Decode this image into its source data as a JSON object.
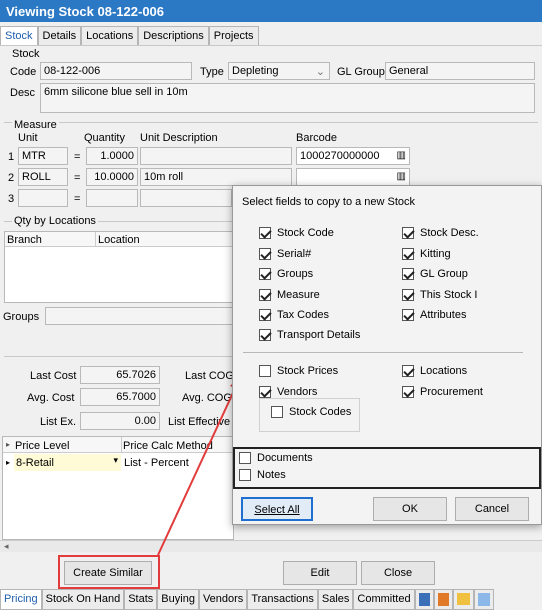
{
  "window": {
    "title": "Viewing Stock 08-122-006"
  },
  "tabs": [
    "Stock",
    "Details",
    "Locations",
    "Descriptions",
    "Projects"
  ],
  "stock": {
    "section": "Stock",
    "code_label": "Code",
    "code": "08-122-006",
    "type_label": "Type",
    "type": "Depleting",
    "gl_label": "GL Group",
    "gl": "General",
    "desc_label": "Desc",
    "desc": "6mm silicone blue sell in 10m"
  },
  "measure": {
    "section": "Measure",
    "unit_label": "Unit",
    "qty_label": "Quantity",
    "udesc_label": "Unit Description",
    "barcode_label": "Barcode",
    "rows": [
      {
        "n": "1",
        "unit": "MTR",
        "eq": "=",
        "qty": "1.0000",
        "udesc": "",
        "barcode": "1000270000000"
      },
      {
        "n": "2",
        "unit": "ROLL",
        "eq": "=",
        "qty": "10.0000",
        "udesc": "10m roll",
        "barcode": ""
      },
      {
        "n": "3",
        "unit": "",
        "eq": "=",
        "qty": "",
        "udesc": "",
        "barcode": ""
      }
    ]
  },
  "qty_locations": {
    "section": "Qty by Locations",
    "col_branch": "Branch",
    "col_location": "Location"
  },
  "groups_label": "Groups",
  "costs": {
    "last_cost_label": "Last Cost",
    "last_cost": "65.7026",
    "avg_cost_label": "Avg. Cost",
    "avg_cost": "65.7000",
    "list_ex_label": "List Ex.",
    "list_ex": "0.00",
    "last_cog_label": "Last COG",
    "avg_cog_label": "Avg. COG",
    "list_eff_label": "List Effective"
  },
  "price": {
    "col_level": "Price Level",
    "col_method": "Price Calc Method",
    "level": "8-Retail",
    "method": "List - Percent"
  },
  "buttons": {
    "create_similar": "Create Similar",
    "edit": "Edit",
    "close": "Close"
  },
  "bottom_tabs": [
    "Pricing",
    "Stock On Hand",
    "Stats",
    "Buying",
    "Vendors",
    "Transactions",
    "Sales",
    "Committed"
  ],
  "dialog": {
    "title": "Select fields to copy to a new Stock",
    "left": [
      {
        "label": "Stock Code",
        "checked": true
      },
      {
        "label": "Serial#",
        "checked": true
      },
      {
        "label": "Groups",
        "checked": true
      },
      {
        "label": "Measure",
        "checked": true
      },
      {
        "label": "Tax Codes",
        "checked": true
      },
      {
        "label": "Transport Details",
        "checked": true
      }
    ],
    "right": [
      {
        "label": "Stock Desc.",
        "checked": true
      },
      {
        "label": "Kitting",
        "checked": true
      },
      {
        "label": "GL Group",
        "checked": true
      },
      {
        "label": "This Stock I",
        "checked": true
      },
      {
        "label": "Attributes",
        "checked": true
      }
    ],
    "stock_prices": "Stock Prices",
    "vendors": "Vendors",
    "stock_codes": "Stock Codes",
    "locations": "Locations",
    "procurement": "Procurement",
    "documents": "Documents",
    "notes": "Notes",
    "select_all": "Select All",
    "ok": "OK",
    "cancel": "Cancel"
  },
  "colors": {
    "title_bar": "#2b78c5",
    "accent": "#1f5fae",
    "arrow": "#e23b3b",
    "price_row": "#fffbd6"
  }
}
